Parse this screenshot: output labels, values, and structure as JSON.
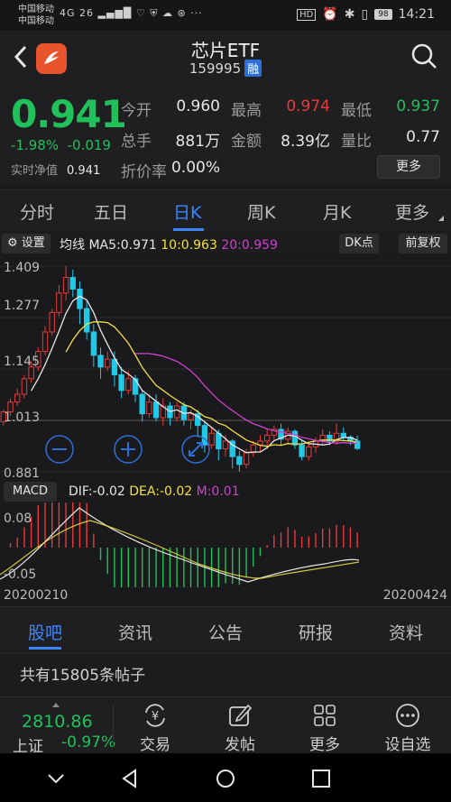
{
  "status_bar": {
    "carrier1": "中国移动",
    "carrier2": "中国移动",
    "signal": "4G 26",
    "battery": "98",
    "time": "14:21"
  },
  "header": {
    "title": "芯片ETF",
    "code": "159995",
    "badge": "融"
  },
  "quote": {
    "price": "0.941",
    "change_pct": "-1.98%",
    "change_abs": "-0.019",
    "nav_label": "实时净值",
    "nav_value": "0.941",
    "open_label": "今开",
    "open_value": "0.960",
    "high_label": "最高",
    "high_value": "0.974",
    "low_label": "最低",
    "low_value": "0.937",
    "volume_label": "总手",
    "volume_value": "881万",
    "amount_label": "金额",
    "amount_value": "8.39亿",
    "ratio_label": "量比",
    "ratio_value": "0.77",
    "discount_label": "折价率",
    "discount_value": "0.00%",
    "more_button": "更多",
    "colors": {
      "down": "#20c05a",
      "up": "#e83a3a"
    }
  },
  "tabs": [
    "分时",
    "五日",
    "日K",
    "周K",
    "月K",
    "更多"
  ],
  "toolbar": {
    "settings": "设置",
    "ma_title": "均线",
    "ma5": "MA5:0.971",
    "ma10": "10:0.963",
    "ma20": "20:0.959",
    "dk_button": "DK点",
    "adjust_button": "前复权"
  },
  "kline_axis": [
    "1.409",
    "1.277",
    "1.145",
    "1.013",
    "0.881"
  ],
  "macd": {
    "button": "MACD",
    "dif": "DIF:-0.02",
    "dea": "DEA:-0.02",
    "m": "M:0.01",
    "axis_top": "0.08",
    "axis_bottom": "-0.05"
  },
  "dates": {
    "start": "20200210",
    "end": "20200424"
  },
  "bottom_tabs": [
    "股吧",
    "资讯",
    "公告",
    "研报",
    "资料"
  ],
  "post_count": "共有15805条帖子",
  "footer": {
    "index_value": "2810.86",
    "index_name": "上证",
    "index_pct": "-0.97%",
    "items": [
      "交易",
      "发帖",
      "更多",
      "设自选"
    ]
  },
  "chart_data": {
    "type": "candlestick",
    "ylim": [
      0.881,
      1.409
    ],
    "yticks": [
      1.409,
      1.277,
      1.145,
      1.013,
      0.881
    ],
    "x_start": "20200210",
    "x_end": "20200424",
    "candles": [
      [
        1.01,
        1.035,
        1.0,
        1.04
      ],
      [
        1.035,
        1.06,
        1.025,
        1.07
      ],
      [
        1.06,
        1.08,
        1.05,
        1.095
      ],
      [
        1.08,
        1.12,
        1.07,
        1.13
      ],
      [
        1.12,
        1.15,
        1.11,
        1.165
      ],
      [
        1.15,
        1.19,
        1.14,
        1.2
      ],
      [
        1.19,
        1.24,
        1.18,
        1.255
      ],
      [
        1.24,
        1.29,
        1.23,
        1.3
      ],
      [
        1.29,
        1.34,
        1.28,
        1.36
      ],
      [
        1.34,
        1.38,
        1.32,
        1.409
      ],
      [
        1.38,
        1.35,
        1.33,
        1.4
      ],
      [
        1.35,
        1.3,
        1.26,
        1.37
      ],
      [
        1.3,
        1.24,
        1.22,
        1.32
      ],
      [
        1.24,
        1.18,
        1.15,
        1.26
      ],
      [
        1.18,
        1.15,
        1.12,
        1.2
      ],
      [
        1.15,
        1.17,
        1.14,
        1.19
      ],
      [
        1.17,
        1.13,
        1.1,
        1.19
      ],
      [
        1.13,
        1.09,
        1.07,
        1.15
      ],
      [
        1.09,
        1.12,
        1.08,
        1.14
      ],
      [
        1.12,
        1.08,
        1.06,
        1.13
      ],
      [
        1.08,
        1.03,
        1.01,
        1.09
      ],
      [
        1.03,
        1.06,
        1.02,
        1.08
      ],
      [
        1.06,
        1.02,
        1.01,
        1.08
      ],
      [
        1.02,
        1.05,
        1.0,
        1.07
      ],
      [
        1.05,
        1.02,
        1.0,
        1.06
      ],
      [
        1.02,
        1.05,
        1.01,
        1.06
      ],
      [
        1.05,
        1.015,
        1.0,
        1.06
      ],
      [
        1.015,
        1.03,
        0.99,
        1.04
      ],
      [
        1.03,
        1.0,
        0.97,
        1.04
      ],
      [
        1.0,
        0.95,
        0.93,
        1.01
      ],
      [
        0.95,
        0.98,
        0.94,
        0.995
      ],
      [
        0.98,
        0.94,
        0.91,
        0.99
      ],
      [
        0.94,
        0.96,
        0.92,
        0.975
      ],
      [
        0.96,
        0.92,
        0.89,
        0.965
      ],
      [
        0.92,
        0.9,
        0.881,
        0.935
      ],
      [
        0.9,
        0.93,
        0.89,
        0.94
      ],
      [
        0.93,
        0.95,
        0.92,
        0.96
      ],
      [
        0.95,
        0.96,
        0.93,
        0.975
      ],
      [
        0.96,
        0.975,
        0.94,
        0.99
      ],
      [
        0.975,
        0.99,
        0.96,
        1.0
      ],
      [
        0.99,
        0.965,
        0.95,
        1.005
      ],
      [
        0.965,
        0.985,
        0.955,
        0.995
      ],
      [
        0.985,
        0.95,
        0.94,
        0.99
      ],
      [
        0.95,
        0.92,
        0.91,
        0.96
      ],
      [
        0.92,
        0.945,
        0.91,
        0.955
      ],
      [
        0.945,
        0.96,
        0.93,
        0.97
      ],
      [
        0.96,
        0.975,
        0.95,
        0.99
      ],
      [
        0.975,
        0.96,
        0.95,
        0.985
      ],
      [
        0.96,
        0.98,
        0.95,
        1.005
      ],
      [
        0.98,
        0.97,
        0.96,
        0.995
      ],
      [
        0.97,
        0.96,
        0.95,
        0.975
      ],
      [
        0.96,
        0.941,
        0.937,
        0.974
      ]
    ]
  }
}
